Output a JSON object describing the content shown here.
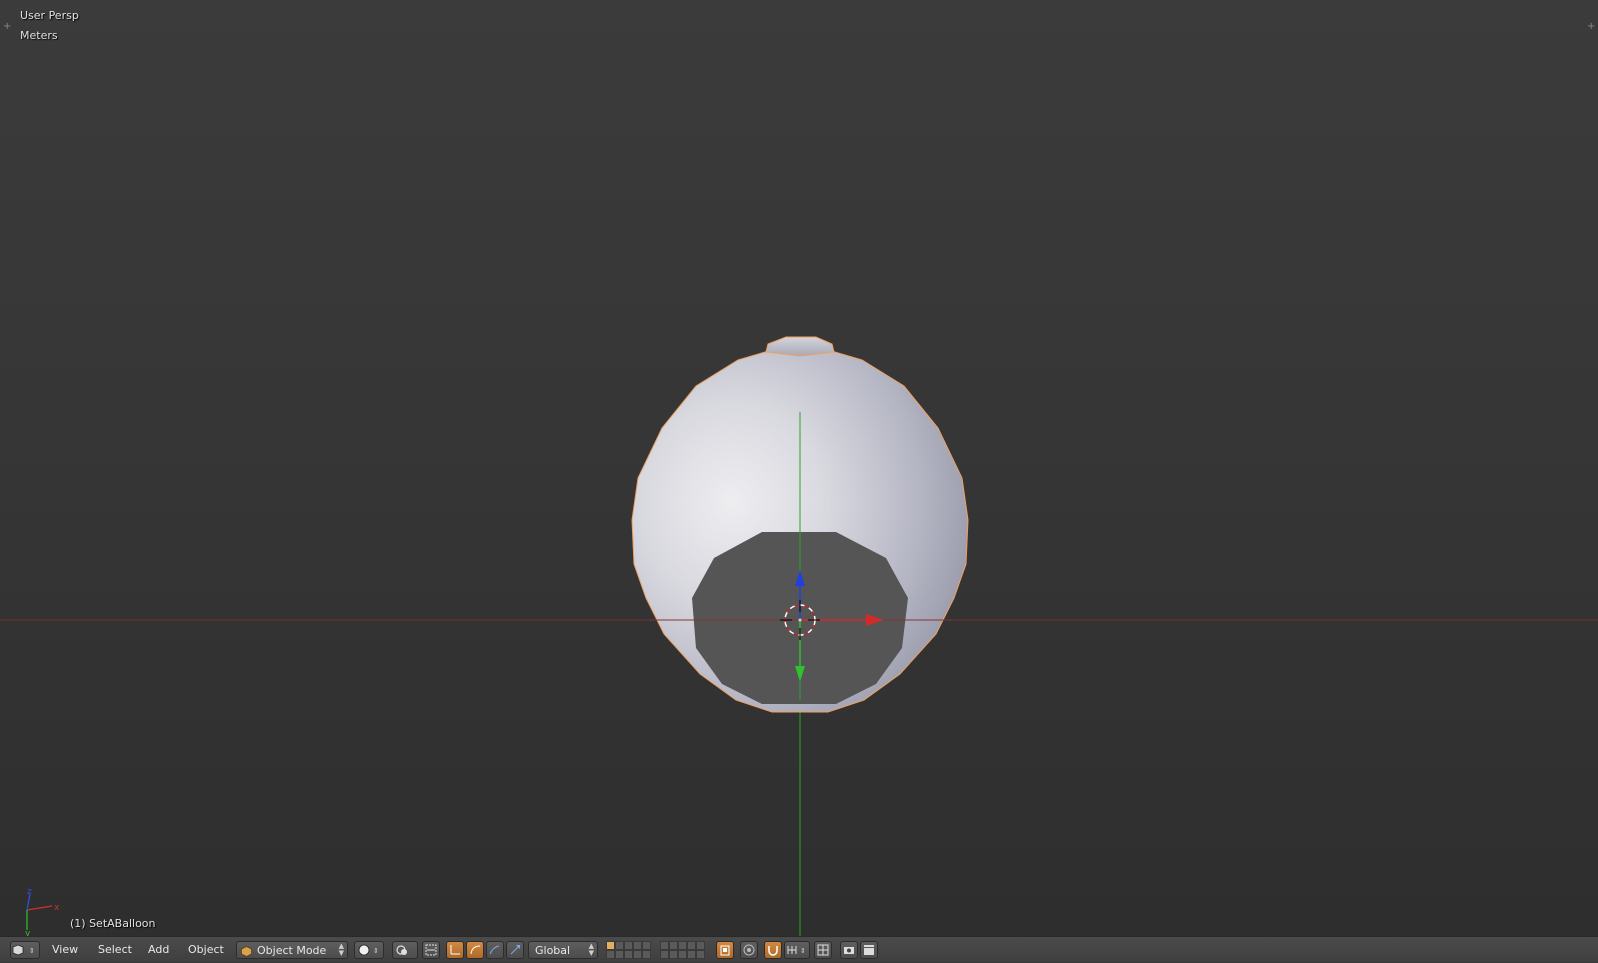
{
  "viewport": {
    "view_label": "User Persp",
    "units_label": "Meters",
    "object_label": "(1) SetABalloon",
    "axis_icon": "mini-axes-icon",
    "object": "balloon-mesh",
    "gizmo": "translate-manipulator-icon",
    "cursor": "3d-cursor-icon"
  },
  "header": {
    "editor_type_icon": "3d-view-icon",
    "menus": [
      "View",
      "Select",
      "Add",
      "Object"
    ],
    "mode": {
      "label": "Object Mode",
      "icon": "object-cube-icon"
    },
    "shading_icon": "solid-shading-icon",
    "pivot_icon": "pivot-point-icon",
    "manipulator_icons": [
      "manipulator-toggle-icon",
      "translate-icon",
      "rotate-icon",
      "scale-icon"
    ],
    "orientation": "Global",
    "lock_layers_icon": "lock-layers-icon",
    "proportional_icon": "proportional-edit-icon",
    "snap_icon": "snap-magnet-icon",
    "snap_target_icon": "snap-increment-icon",
    "opengl_render_icon": "camera-icon",
    "opengl_anim_icon": "clapboard-icon"
  },
  "colors": {
    "x_axis": "#c23030",
    "y_axis": "#30c030",
    "z_axis": "#2040e0",
    "selection_outline": "#f0a060",
    "toggle_on": "#c87d38"
  }
}
